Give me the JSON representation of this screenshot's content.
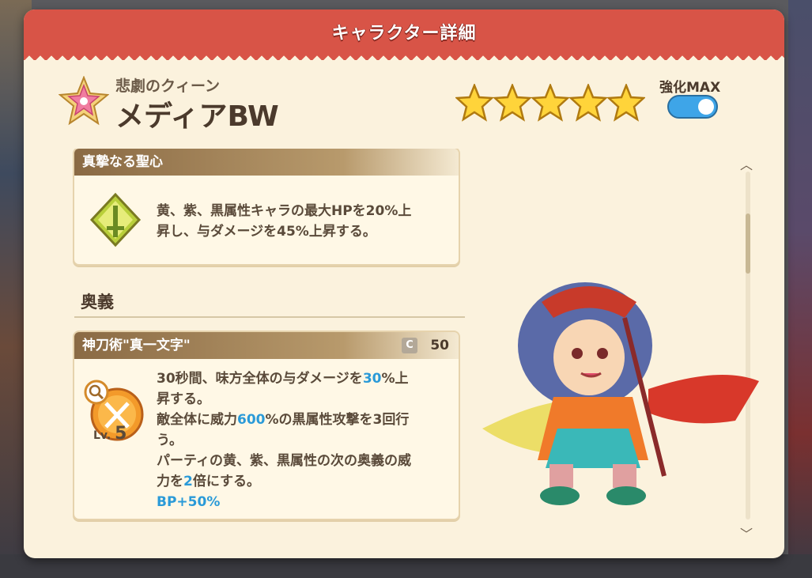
{
  "dialog": {
    "title": "キャラクター詳細"
  },
  "character": {
    "subtitle": "悲劇のクィーン",
    "name": "メディアBW",
    "star_count": 5,
    "max_label": "強化MAX",
    "max_toggle_on": true
  },
  "ability": {
    "header": "真摯なる聖心",
    "lines": [
      "黄、紫、黒属性キャラの最大HPを20%上",
      "昇し、与ダメージを45%上昇する。"
    ],
    "icon": "sword-emblem-icon"
  },
  "ougi": {
    "section_title": "奥義",
    "skill_name": "神刀術\"真一文字\"",
    "cost_badge": "C",
    "cost_value": "50",
    "level_label": "Lv.",
    "level_value": "5",
    "desc": {
      "l1a": "30秒間、味方全体の与ダメージを",
      "l1b": "30",
      "l1c": "%上",
      "l2": "昇する。",
      "l3a": "敵全体に威力",
      "l3b": "600",
      "l3c": "%の黒属性攻撃を3回行",
      "l4": "う。",
      "l5": "パーティの黄、紫、黒属性の次の奥義の威",
      "l6a": "力を",
      "l6b": "2",
      "l6c": "倍にする。",
      "l7": "BP+50%"
    },
    "icon": "crossed-swords-icon"
  },
  "colors": {
    "title_bar": "#d85447",
    "panel": "#fbf2dd",
    "highlight_blue": "#2a9ad8",
    "toggle_on": "#3ea5e8"
  }
}
